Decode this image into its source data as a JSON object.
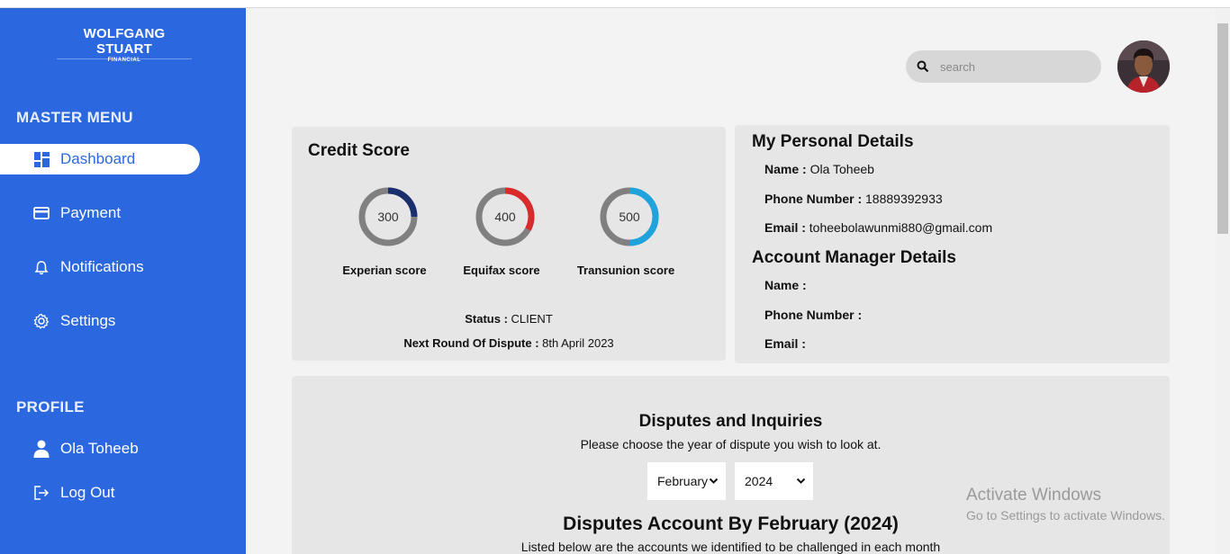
{
  "brand": {
    "name": "WOLFGANG STUART",
    "sub": "FINANCIAL"
  },
  "sidebar": {
    "master_heading": "MASTER MENU",
    "items": [
      {
        "label": "Dashboard",
        "icon": "dashboard-icon"
      },
      {
        "label": "Payment",
        "icon": "credit-card-icon"
      },
      {
        "label": "Notifications",
        "icon": "bell-icon"
      },
      {
        "label": "Settings",
        "icon": "gear-icon"
      }
    ],
    "profile_heading": "PROFILE",
    "profile_name": "Ola Toheeb",
    "logout_label": "Log Out"
  },
  "search": {
    "placeholder": "search"
  },
  "credit": {
    "title": "Credit Score",
    "scores": [
      {
        "value": "300",
        "label": "Experian score",
        "color": "#1a2e6e",
        "fraction": 0.25
      },
      {
        "value": "400",
        "label": "Equifax score",
        "color": "#d92b2b",
        "fraction": 0.33
      },
      {
        "value": "500",
        "label": "Transunion score",
        "color": "#1fa3dc",
        "fraction": 0.5
      }
    ],
    "status_key": "Status :",
    "status_val": "CLIENT",
    "next_key": "Next Round Of Dispute :",
    "next_val": "8th April 2023"
  },
  "personal": {
    "title": "My Personal Details",
    "name_key": "Name :",
    "name_val": "Ola Toheeb",
    "phone_key": "Phone Number :",
    "phone_val": "18889392933",
    "email_key": "Email :",
    "email_val": "toheebolawunmi880@gmail.com"
  },
  "manager": {
    "title": "Account Manager Details",
    "name_key": "Name :",
    "phone_key": "Phone Number :",
    "email_key": "Email :"
  },
  "disputes": {
    "title": "Disputes and Inquiries",
    "subtitle": "Please choose the year of dispute you wish to look at.",
    "month": "February",
    "year": "2024",
    "account_title": "Disputes Account By February (2024)",
    "account_subtitle": "Listed below are the accounts we identified to be challenged in each month"
  },
  "watermark": {
    "line1": "Activate Windows",
    "line2": "Go to Settings to activate Windows."
  }
}
